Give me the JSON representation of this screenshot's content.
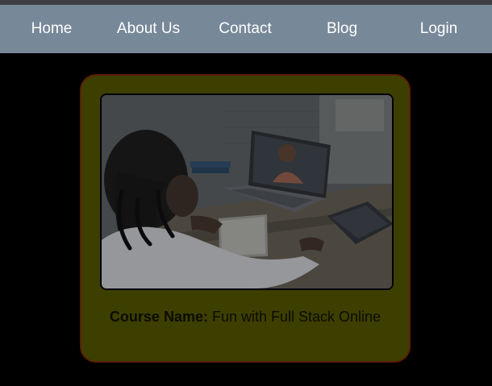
{
  "nav": {
    "items": [
      {
        "label": "Home"
      },
      {
        "label": "About Us"
      },
      {
        "label": "Contact"
      },
      {
        "label": "Blog"
      },
      {
        "label": "Login"
      }
    ]
  },
  "card": {
    "course_label": "Course Name:",
    "course_name": "Fun with Full Stack Online"
  },
  "colors": {
    "navbar": "#778899",
    "page_background": "#000000",
    "card_background": "#3d3f00",
    "card_border": "#5a1f06"
  }
}
